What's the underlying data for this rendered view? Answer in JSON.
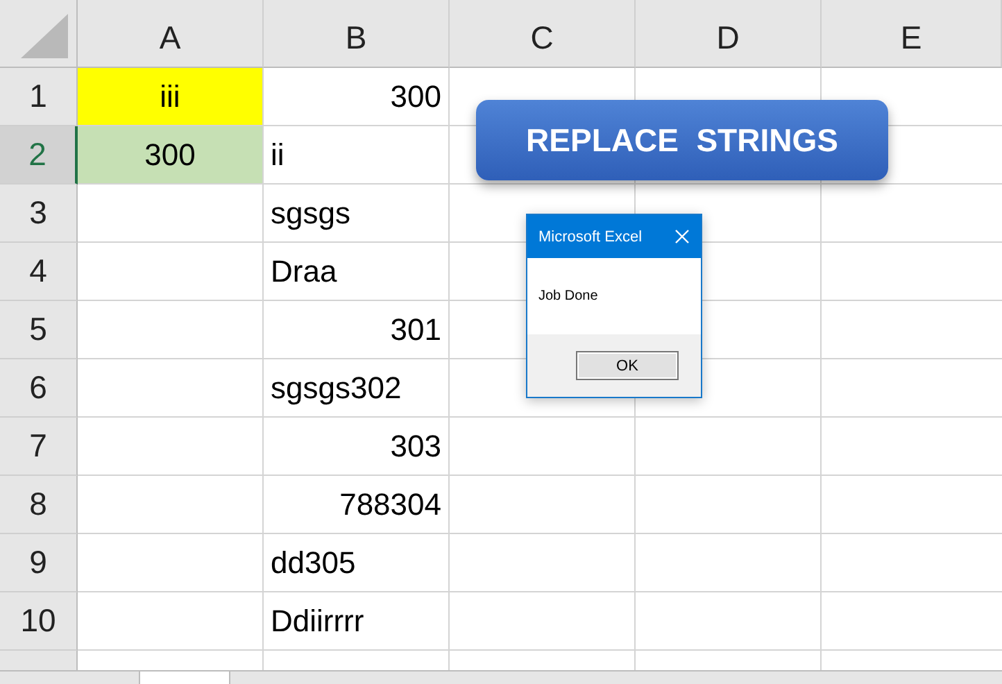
{
  "columns": [
    {
      "label": "A"
    },
    {
      "label": "B"
    },
    {
      "label": "C"
    },
    {
      "label": "D"
    },
    {
      "label": "E"
    }
  ],
  "rows": [
    {
      "label": "1",
      "selected": false,
      "col_a": {
        "value": "iii",
        "kind": "centered",
        "color": "#ffff00"
      },
      "col_b": {
        "value": "300",
        "kind": "number"
      }
    },
    {
      "label": "2",
      "selected": true,
      "col_a": {
        "value": "300",
        "kind": "centered",
        "color": "#c6e0b4"
      },
      "col_b": {
        "value": "ii",
        "kind": "text"
      }
    },
    {
      "label": "3",
      "selected": false,
      "col_b": {
        "value": "sgsgs",
        "kind": "text"
      }
    },
    {
      "label": "4",
      "selected": false,
      "col_b": {
        "value": "Draa",
        "kind": "text"
      }
    },
    {
      "label": "5",
      "selected": false,
      "col_b": {
        "value": "301",
        "kind": "number"
      }
    },
    {
      "label": "6",
      "selected": false,
      "col_b": {
        "value": "sgsgs302",
        "kind": "text"
      }
    },
    {
      "label": "7",
      "selected": false,
      "col_b": {
        "value": "303",
        "kind": "number"
      }
    },
    {
      "label": "8",
      "selected": false,
      "col_b": {
        "value": "788304",
        "kind": "number"
      }
    },
    {
      "label": "9",
      "selected": false,
      "col_b": {
        "value": "dd305",
        "kind": "text"
      }
    },
    {
      "label": "10",
      "selected": false,
      "col_b": {
        "value": "Ddiirrrr",
        "kind": "text"
      }
    }
  ],
  "macro_button": {
    "label": "REPLACE  STRINGS"
  },
  "dialog": {
    "title": "Microsoft Excel",
    "message": "Job Done",
    "buttons": [
      "OK"
    ]
  }
}
